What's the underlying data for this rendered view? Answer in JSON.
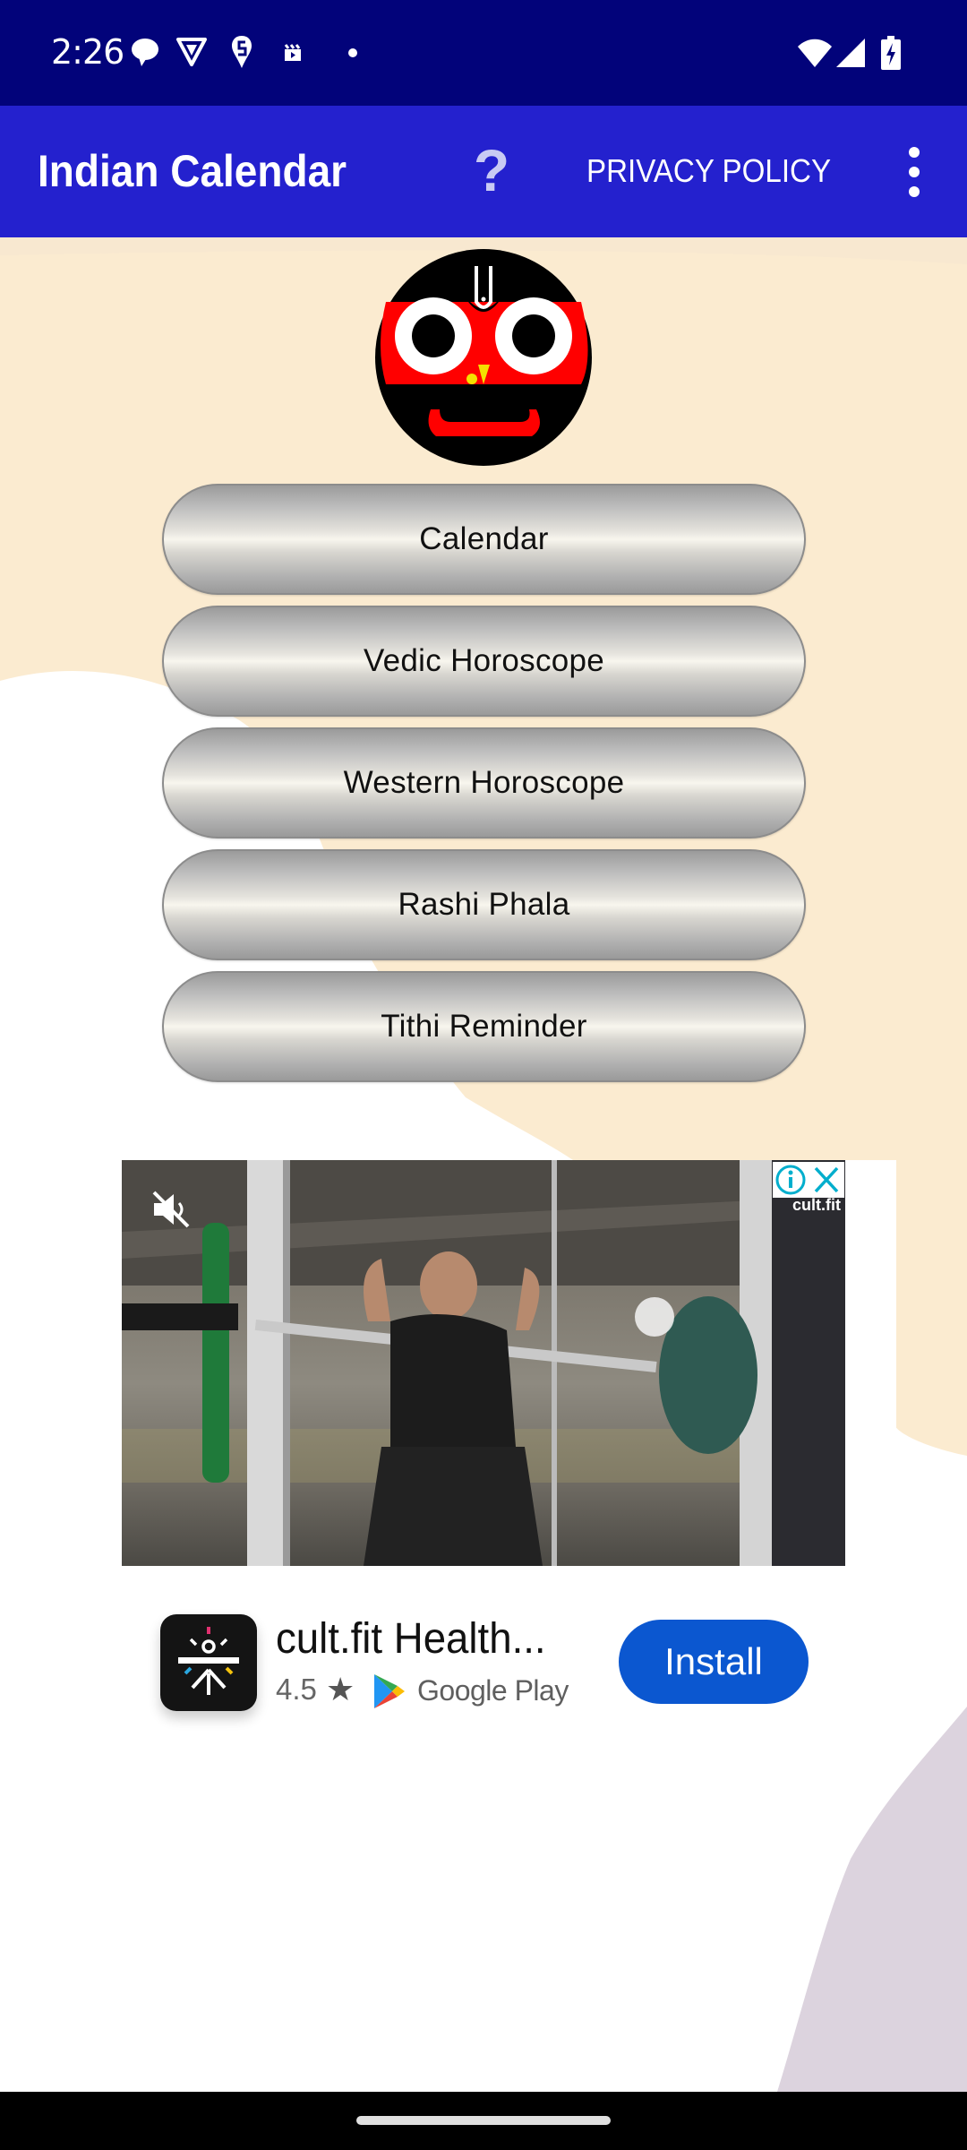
{
  "status_bar": {
    "time": "2:26",
    "notification_icons": [
      "messages-icon",
      "android-triangle-icon",
      "swiggy-icon",
      "video-clapper-icon",
      "dot-icon"
    ],
    "system_icons": [
      "wifi-icon",
      "cellular-signal-icon",
      "battery-charging-icon"
    ]
  },
  "app_bar": {
    "title": "Indian Calendar",
    "help_label": "?",
    "privacy_label": "PRIVACY POLICY",
    "overflow_icon": "more-vert-icon",
    "color": "#2421ce"
  },
  "logo": {
    "icon": "jagannath-face-logo"
  },
  "menu": {
    "items": [
      {
        "label": "Calendar"
      },
      {
        "label": "Vedic Horoscope"
      },
      {
        "label": "Western Horoscope"
      },
      {
        "label": "Rashi Phala"
      },
      {
        "label": "Tithi Reminder"
      }
    ]
  },
  "ad": {
    "brand_watermark": "cult.fit",
    "mute_icon": "volume-muted-icon",
    "info_icon": "adchoices-info-icon",
    "close_icon": "close-icon",
    "app_name": "cult.fit Health...",
    "rating": "4.5",
    "star": "★",
    "store_label": "Google Play",
    "install_label": "Install",
    "install_color": "#0b57d0"
  },
  "colors": {
    "status_bar": "#02037a",
    "background_cream": "#fbebd0",
    "background_lilac": "#dcd3de"
  }
}
